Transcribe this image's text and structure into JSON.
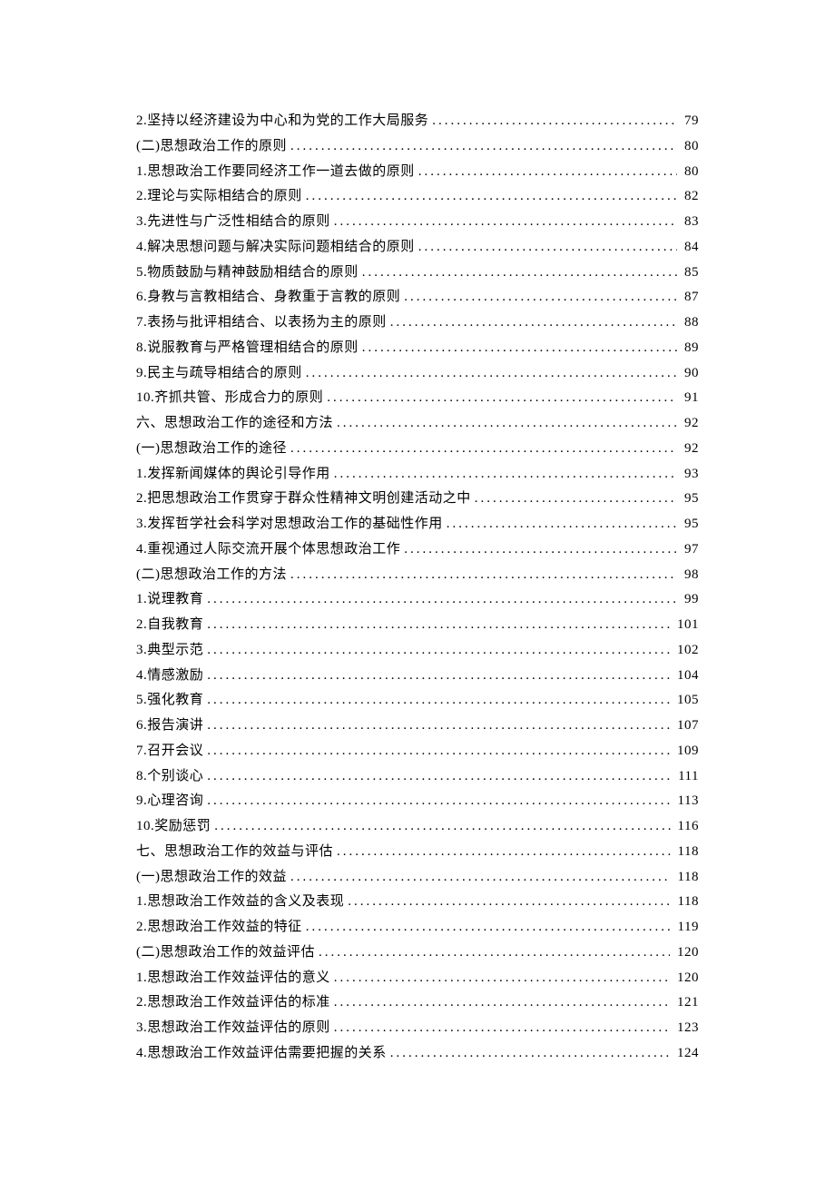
{
  "toc": [
    {
      "label": "2.坚持以经济建设为中心和为党的工作大局服务",
      "page": "79"
    },
    {
      "label": "(二)思想政治工作的原则",
      "page": "80"
    },
    {
      "label": "1.思想政治工作要同经济工作一道去做的原则",
      "page": "80"
    },
    {
      "label": "2.理论与实际相结合的原则",
      "page": "82"
    },
    {
      "label": "3.先进性与广泛性相结合的原则",
      "page": "83"
    },
    {
      "label": "4.解决思想问题与解决实际问题相结合的原则",
      "page": "84"
    },
    {
      "label": "5.物质鼓励与精神鼓励相结合的原则",
      "page": "85"
    },
    {
      "label": "6.身教与言教相结合、身教重于言教的原则",
      "page": "87"
    },
    {
      "label": "7.表扬与批评相结合、以表扬为主的原则",
      "page": "88"
    },
    {
      "label": "8.说服教育与严格管理相结合的原则",
      "page": "89"
    },
    {
      "label": "9.民主与疏导相结合的原则",
      "page": "90"
    },
    {
      "label": "10.齐抓共管、形成合力的原则",
      "page": "91"
    },
    {
      "label": "六、思想政治工作的途径和方法",
      "page": "92"
    },
    {
      "label": "(一)思想政治工作的途径",
      "page": "92"
    },
    {
      "label": "1.发挥新闻媒体的舆论引导作用",
      "page": "93"
    },
    {
      "label": "2.把思想政治工作贯穿于群众性精神文明创建活动之中",
      "page": "95"
    },
    {
      "label": "3.发挥哲学社会科学对思想政治工作的基础性作用",
      "page": "95"
    },
    {
      "label": "4.重视通过人际交流开展个体思想政治工作",
      "page": "97"
    },
    {
      "label": "(二)思想政治工作的方法",
      "page": "98"
    },
    {
      "label": "1.说理教育",
      "page": "99"
    },
    {
      "label": "2.自我教育",
      "page": "101"
    },
    {
      "label": "3.典型示范",
      "page": "102"
    },
    {
      "label": "4.情感激励",
      "page": "104"
    },
    {
      "label": "5.强化教育",
      "page": "105"
    },
    {
      "label": "6.报告演讲",
      "page": "107"
    },
    {
      "label": "7.召开会议",
      "page": "109"
    },
    {
      "label": "8.个别谈心",
      "page": "111"
    },
    {
      "label": "9.心理咨询",
      "page": "113"
    },
    {
      "label": "10.奖励惩罚",
      "page": "116"
    },
    {
      "label": "七、思想政治工作的效益与评估",
      "page": "118"
    },
    {
      "label": "(一)思想政治工作的效益",
      "page": "118"
    },
    {
      "label": "1.思想政治工作效益的含义及表现",
      "page": "118"
    },
    {
      "label": "2.思想政治工作效益的特征",
      "page": "119"
    },
    {
      "label": "(二)思想政治工作的效益评估",
      "page": "120"
    },
    {
      "label": "1.思想政治工作效益评估的意义",
      "page": "120"
    },
    {
      "label": "2.思想政治工作效益评估的标准",
      "page": "121"
    },
    {
      "label": "3.思想政治工作效益评估的原则",
      "page": "123"
    },
    {
      "label": "4.思想政治工作效益评估需要把握的关系",
      "page": "124"
    }
  ]
}
